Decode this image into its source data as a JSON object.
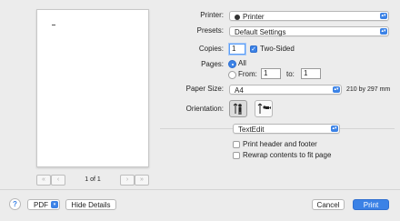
{
  "preview": {
    "page_indicator": "1 of 1",
    "first_glyph": "«",
    "prev_glyph": "‹",
    "next_glyph": "›",
    "last_glyph": "»"
  },
  "printer": {
    "label": "Printer:",
    "value": "Printer"
  },
  "presets": {
    "label": "Presets:",
    "value": "Default Settings"
  },
  "copies": {
    "label": "Copies:",
    "value": "1",
    "two_sided_label": "Two-Sided",
    "two_sided_checked": true
  },
  "pages": {
    "label": "Pages:",
    "all_label": "All",
    "from_label": "From:",
    "from_value": "1",
    "to_label": "to:",
    "to_value": "1"
  },
  "paper_size": {
    "label": "Paper Size:",
    "value": "A4",
    "dimensions": "210 by 297 mm"
  },
  "orientation": {
    "label": "Orientation:",
    "selected": "portrait"
  },
  "app_section": {
    "value": "TextEdit"
  },
  "options": {
    "print_header_footer": "Print header and footer",
    "rewrap_contents": "Rewrap contents to fit page"
  },
  "footer": {
    "help": "?",
    "pdf": "PDF",
    "hide_details": "Hide Details",
    "cancel": "Cancel",
    "print": "Print"
  },
  "colors": {
    "accent": "#3b82e6"
  }
}
